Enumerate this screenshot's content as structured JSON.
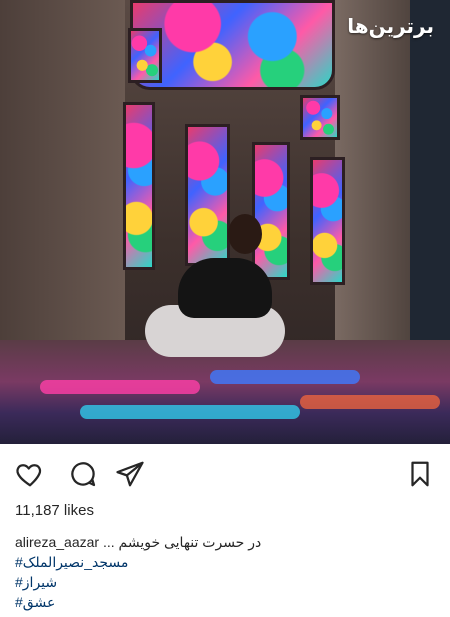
{
  "post": {
    "watermark": "برترین‌ها",
    "likes": "11,187 likes",
    "username": "alireza_aazar",
    "caption": "... در حسرت تنهایی خویشم",
    "hashtags": [
      "#مسجد_نصیرالملک",
      "#شیراز",
      "#عشق"
    ]
  },
  "icons": {
    "like": "heart-icon",
    "comment": "comment-icon",
    "share": "share-icon",
    "save": "save-icon"
  }
}
